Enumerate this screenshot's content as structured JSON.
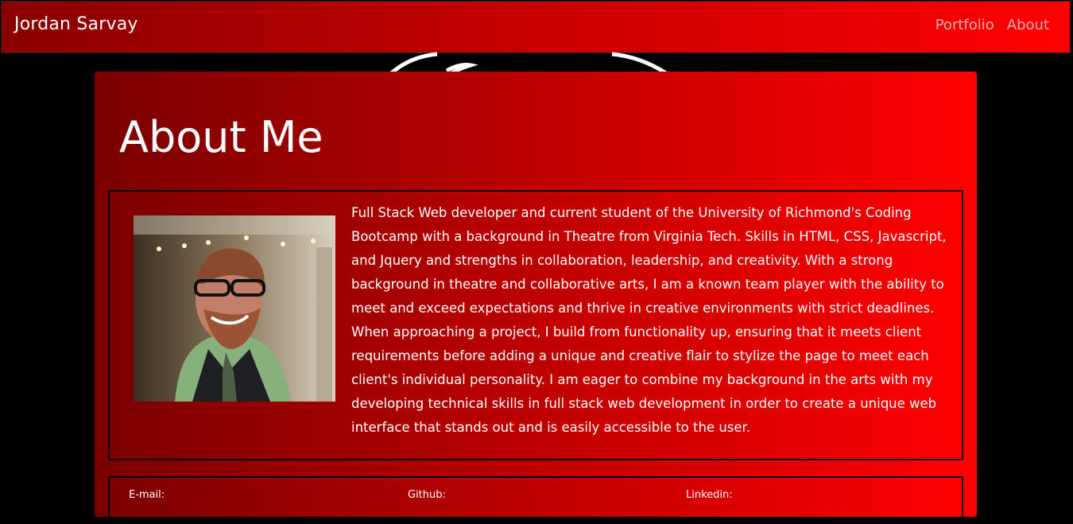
{
  "navbar": {
    "brand": "Jordan Sarvay",
    "links": [
      "Portfolio",
      "About"
    ]
  },
  "about": {
    "title": "About Me",
    "bio": "Full Stack Web developer and current student of the University of Richmond's Coding Bootcamp with a background in Theatre from Virginia Tech. Skills in HTML, CSS, Javascript, and Jquery and strengths in collaboration, leadership, and creativity. With a strong background in theatre and collaborative arts, I am a known team player with the ability to meet and exceed expectations and thrive in creative environments with strict deadlines. When approaching a project, I build from functionality up, ensuring that it meets client requirements before adding a unique and creative flair to stylize the page to meet each client's individual personality. I am eager to combine my background in the arts with my developing technical skills in full stack web development in order to create a unique web interface that stands out and is easily accessible to the user."
  },
  "contact": {
    "labels": [
      "E-mail:",
      "Github:",
      "Linkedin:"
    ]
  },
  "colors": {
    "nav_gradient_start": "#8a0000",
    "nav_gradient_end": "#ff0000",
    "card_gradient_start": "#7a0000",
    "card_gradient_end": "#ff0000",
    "nav_link": "#ffb0b0",
    "text": "#ffffff",
    "page_bg": "#000000"
  },
  "icons": {
    "background_logo": "circular-logo-outline"
  }
}
